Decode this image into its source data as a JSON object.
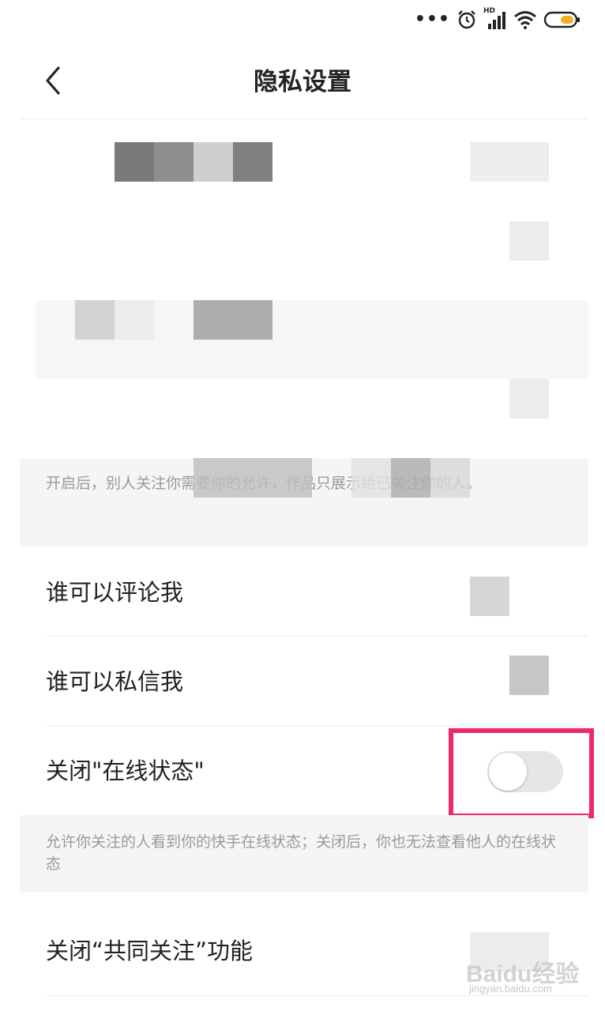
{
  "status_bar": {
    "icons": [
      "more-dots-icon",
      "alarm-icon",
      "hd-signal-icon",
      "wifi-icon",
      "battery-icon"
    ],
    "hd_label": "HD",
    "battery_color": "#f0b020"
  },
  "nav": {
    "title": "隐私设置",
    "back_icon": "chevron-left-icon"
  },
  "sections": {
    "private_account_desc": "开启后，别人关注你需要你的允许，作品只展示给已关注你的人。"
  },
  "rows": {
    "who_can_comment": "谁可以评论我",
    "who_can_message": "谁可以私信我",
    "close_online_status": "关闭\"在线状态\"",
    "close_mutual_follow": "关闭“共同关注”功能"
  },
  "online_status": {
    "toggle_on": false,
    "desc": "允许你关注的人看到你的快手在线状态；关闭后，你也无法查看他人的在线状态"
  },
  "colors": {
    "highlight": "#ee2a66",
    "toggle_off_track": "#e6e6e6"
  },
  "watermark": {
    "main": "Baidu经验",
    "sub": "jingyan.baidu.com"
  }
}
